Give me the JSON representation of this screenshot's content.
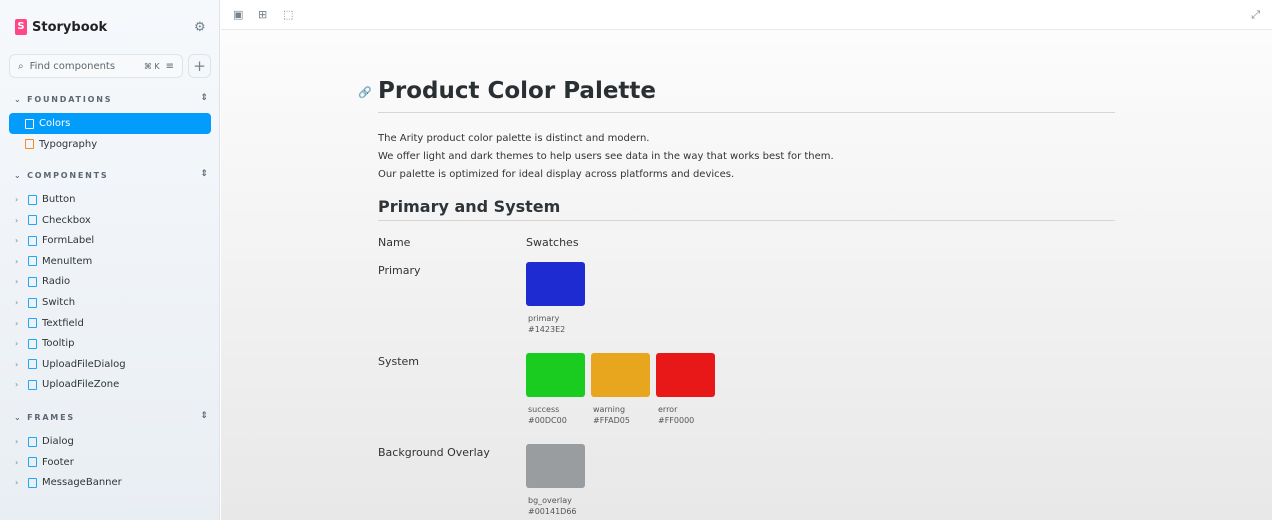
{
  "sidebar": {
    "brand": "Storybook",
    "search_placeholder": "Find components",
    "shortcut": "⌘ K",
    "groups": [
      {
        "label": "FOUNDATIONS",
        "items": [
          {
            "label": "Colors",
            "selected": true
          },
          {
            "label": "Typography"
          }
        ]
      },
      {
        "label": "COMPONENTS",
        "items": [
          {
            "label": "Button"
          },
          {
            "label": "Checkbox"
          },
          {
            "label": "FormLabel"
          },
          {
            "label": "MenuItem"
          },
          {
            "label": "Radio"
          },
          {
            "label": "Switch"
          },
          {
            "label": "Textfield"
          },
          {
            "label": "Tooltip"
          },
          {
            "label": "UploadFileDialog"
          },
          {
            "label": "UploadFileZone"
          }
        ]
      },
      {
        "label": "FRAMES",
        "items": [
          {
            "label": "Dialog"
          },
          {
            "label": "Footer"
          },
          {
            "label": "MessageBanner"
          }
        ]
      }
    ]
  },
  "doc": {
    "title": "Product Color Palette",
    "intro": [
      "The Arity product color palette is distinct and modern.",
      "We offer light and dark themes to help users see data in the way that works best for them.",
      "Our palette is optimized for ideal display across platforms and devices."
    ],
    "section": "Primary and System",
    "col_name": "Name",
    "col_swatches": "Swatches",
    "rows": [
      {
        "name": "Primary",
        "swatches": [
          {
            "label": "primary",
            "hex": "#1423E2",
            "render": "#1e2bd0"
          }
        ]
      },
      {
        "name": "System",
        "swatches": [
          {
            "label": "success",
            "hex": "#00DC00",
            "render": "#19cc1f"
          },
          {
            "label": "warning",
            "hex": "#FFAD05",
            "render": "#e8a61f"
          },
          {
            "label": "error",
            "hex": "#FF0000",
            "render": "#e81818"
          }
        ]
      },
      {
        "name": "Background Overlay",
        "swatches": [
          {
            "label": "bg_overlay",
            "hex": "#00141D66",
            "render": "#999da0"
          }
        ]
      }
    ]
  }
}
